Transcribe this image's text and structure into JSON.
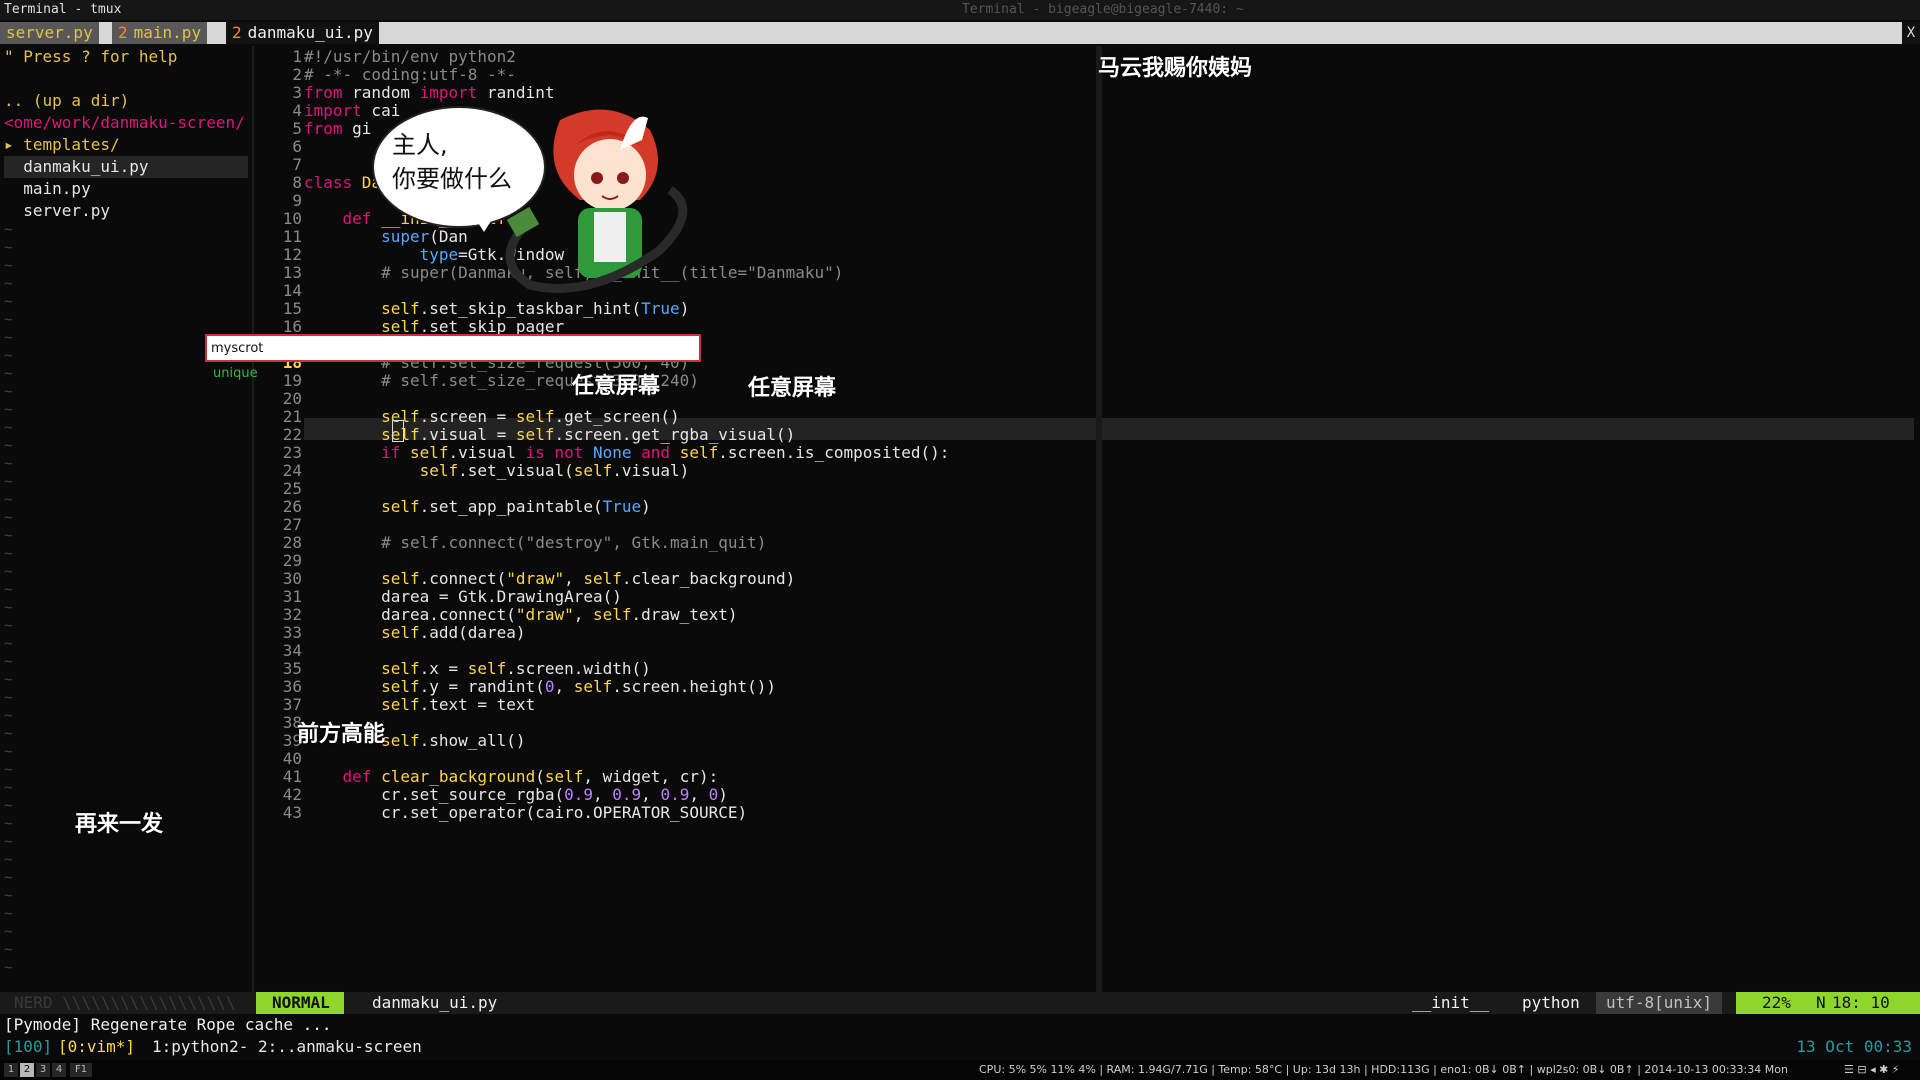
{
  "window": {
    "title": "Terminal - tmux",
    "subtitle": "Terminal - bigeagle@bigeagle-7440: ~"
  },
  "tabs": [
    {
      "num": "",
      "label": "server.py"
    },
    {
      "num": "2",
      "label": "main.py"
    },
    {
      "num": "2",
      "label": "danmaku_ui.py"
    }
  ],
  "tab_close": "X",
  "nerdtree": {
    "help": "\" Press ? for help",
    "updir": ".. (up a dir)",
    "path": "<ome/work/danmaku-screen/",
    "items": [
      {
        "kind": "dir",
        "label": "▸ templates/"
      },
      {
        "kind": "file",
        "label": "  danmaku_ui.py"
      },
      {
        "kind": "file",
        "label": "  main.py"
      },
      {
        "kind": "file",
        "label": "  server.py"
      }
    ],
    "tilde": "~"
  },
  "code": {
    "current_line": 18,
    "lines": [
      {
        "n": 1,
        "html": "<span class='c'>#!/usr/bin/env python2</span>"
      },
      {
        "n": 2,
        "html": "<span class='c'># -*- coding:utf-8 -*-</span>"
      },
      {
        "n": 3,
        "html": "<span class='k'>from</span><span class='t'> random </span><span class='k'>import</span><span class='t'> randint</span>"
      },
      {
        "n": 4,
        "html": "<span class='k'>import</span><span class='t'> cai</span>"
      },
      {
        "n": 5,
        "html": "<span class='k'>from</span><span class='t'> gi</span>"
      },
      {
        "n": 6,
        "html": ""
      },
      {
        "n": 7,
        "html": ""
      },
      {
        "n": 8,
        "html": "<span class='k'>class</span><span class='y'> Danm</span>"
      },
      {
        "n": 9,
        "html": ""
      },
      {
        "n": 10,
        "html": "    <span class='k'>def</span><span class='f'> __init__</span><span class='t'>(</span><span class='y'>self</span>"
      },
      {
        "n": 11,
        "html": "        <span class='b'>super</span><span class='t'>(Dan</span>"
      },
      {
        "n": 12,
        "html": "            <span class='b'>type</span><span class='t'>=Gtk.Window</span>"
      },
      {
        "n": 13,
        "html": "        <span class='c'># super(Danmaku, self).__init__(title=\"Danmaku\")</span>"
      },
      {
        "n": 14,
        "html": ""
      },
      {
        "n": 15,
        "html": "        <span class='y'>self</span><span class='t'>.set_skip_taskbar_hint(</span><span class='b'>True</span><span class='t'>)</span>"
      },
      {
        "n": 16,
        "html": "        <span class='y'>self</span><span class='t'>.set_skip_pager</span>"
      },
      {
        "n": 17,
        "html": "        <span class='c'># self.set_decorated(False)</span>"
      },
      {
        "n": 18,
        "html": "        <span class='c'># self.set_size_request(500, 40)</span>"
      },
      {
        "n": 19,
        "html": "        <span class='c'># self.set_size_request(370, 240)</span>"
      },
      {
        "n": 20,
        "html": ""
      },
      {
        "n": 21,
        "html": "        <span class='y'>self</span><span class='t'>.screen = </span><span class='y'>self</span><span class='t'>.get_screen()</span>"
      },
      {
        "n": 22,
        "html": "        <span class='y'>self</span><span class='t'>.visual = </span><span class='y'>self</span><span class='t'>.screen.get_rgba_visual()</span>"
      },
      {
        "n": 23,
        "html": "        <span class='k'>if</span><span class='y'> self</span><span class='t'>.visual </span><span class='k'>is not</span><span class='b'> None</span><span class='k'> and</span><span class='y'> self</span><span class='t'>.screen.is_composited():</span>"
      },
      {
        "n": 24,
        "html": "            <span class='y'>self</span><span class='t'>.set_visual(</span><span class='y'>self</span><span class='t'>.visual)</span>"
      },
      {
        "n": 25,
        "html": ""
      },
      {
        "n": 26,
        "html": "        <span class='y'>self</span><span class='t'>.set_app_paintable(</span><span class='b'>True</span><span class='t'>)</span>"
      },
      {
        "n": 27,
        "html": ""
      },
      {
        "n": 28,
        "html": "        <span class='c'># self.connect(\"destroy\", Gtk.main_quit)</span>"
      },
      {
        "n": 29,
        "html": ""
      },
      {
        "n": 30,
        "html": "        <span class='y'>self</span><span class='t'>.connect(</span><span class='s'>\"draw\"</span><span class='t'>, </span><span class='y'>self</span><span class='t'>.clear_background)</span>"
      },
      {
        "n": 31,
        "html": "        <span class='t'>darea = Gtk.DrawingArea()</span>"
      },
      {
        "n": 32,
        "html": "        <span class='t'>darea.connect(</span><span class='s'>\"draw\"</span><span class='t'>, </span><span class='y'>self</span><span class='t'>.draw_text)</span>"
      },
      {
        "n": 33,
        "html": "        <span class='y'>self</span><span class='t'>.add(darea)</span>"
      },
      {
        "n": 34,
        "html": ""
      },
      {
        "n": 35,
        "html": "        <span class='y'>self</span><span class='t'>.x = </span><span class='y'>self</span><span class='t'>.screen.width()</span>"
      },
      {
        "n": 36,
        "html": "        <span class='y'>self</span><span class='t'>.y = randint(</span><span class='n'>0</span><span class='t'>, </span><span class='y'>self</span><span class='t'>.screen.height())</span>"
      },
      {
        "n": 37,
        "html": "        <span class='y'>self</span><span class='t'>.text = text</span>"
      },
      {
        "n": 38,
        "html": ""
      },
      {
        "n": 39,
        "html": "        <span class='y'>self</span><span class='t'>.show_all()</span>"
      },
      {
        "n": 40,
        "html": ""
      },
      {
        "n": 41,
        "html": "    <span class='k'>def</span><span class='f'> clear_background</span><span class='t'>(</span><span class='y'>self</span><span class='t'>, widget, cr):</span>"
      },
      {
        "n": 42,
        "html": "        <span class='t'>cr.set_source_rgba(</span><span class='n'>0.9</span><span class='t'>, </span><span class='n'>0.9</span><span class='t'>, </span><span class='n'>0.9</span><span class='t'>, </span><span class='n'>0</span><span class='t'>)</span>"
      },
      {
        "n": 43,
        "html": "        <span class='t'>cr.set_operator(cairo.OPERATOR_SOURCE)</span>"
      }
    ]
  },
  "danmaku": [
    {
      "text": "马云我赐你姨妈"
    },
    {
      "text": "任意屏幕"
    },
    {
      "text": "任意屏幕"
    },
    {
      "text": "前方高能"
    },
    {
      "text": "再来一发"
    }
  ],
  "launcher": {
    "value": "myscrot",
    "hint": "unique"
  },
  "bubble": {
    "line1": "主人,",
    "line2": "你要做什么"
  },
  "statusline": {
    "left_dim": "NERD  \\\\\\\\\\\\\\\\\\\\\\\\\\\\\\\\\\\\",
    "mode": "NORMAL",
    "file": "danmaku_ui.py",
    "func": "__init__",
    "filetype": "python",
    "encoding": "utf-8[unix]",
    "percent": "22%",
    "ln": "Ν",
    "pos": "18: 10"
  },
  "cmdline": "[Pymode] Regenerate Rope cache ...",
  "tmux": {
    "session": "[100]",
    "current": "[0:vim*]",
    "windows": "1:python2- 2:..anmaku-screen",
    "date": "13 Oct 00:33"
  },
  "panel": {
    "workspaces": [
      "1",
      "2",
      "3",
      "4",
      "F1"
    ],
    "sysinfo": "CPU: 5% 5% 11% 4% | RAM: 1.94G/7.71G | Temp: 58°C | Up: 13d 13h | HDD:113G | eno1: 0B↓ 0B↑ | wpl2s0: 0B↓ 0B↑ | 2014-10-13 00:33:34 Mon",
    "tray": "☰ ⊟ ◂ ✱ ⚡"
  },
  "colors": {
    "accent": "#8fd62a",
    "keyword": "#e0147c",
    "string": "#ffd54a",
    "builtin": "#5aa7ff"
  }
}
